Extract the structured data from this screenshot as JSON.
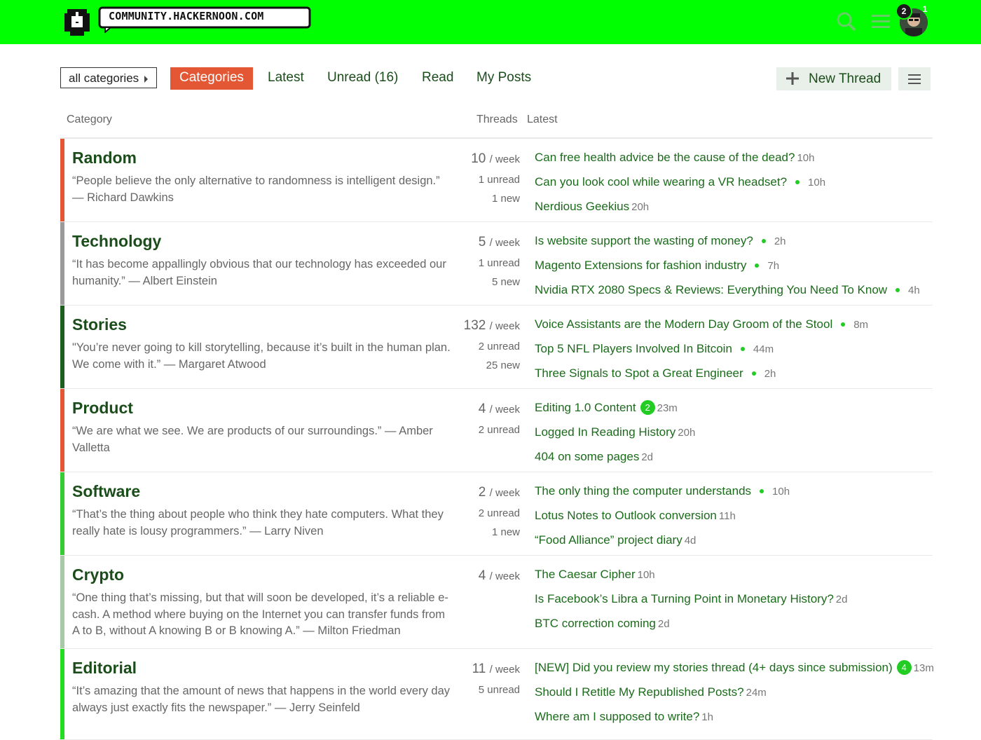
{
  "header": {
    "site_name": "COMMUNITY.HACKERNOON.COM",
    "pm_badge": "2",
    "notif_badge": "1",
    "accent": "#00ff00"
  },
  "nav": {
    "category_dropdown": "all categories",
    "tabs": [
      "Categories",
      "Latest",
      "Unread (16)",
      "Read",
      "My Posts"
    ],
    "new_thread": "New Thread"
  },
  "table": {
    "col_category": "Category",
    "col_threads": "Threads",
    "col_latest": "Latest"
  },
  "categories": [
    {
      "name": "Random",
      "color": "#e45735",
      "description": "“People believe the only alternative to randomness is intelligent design.” — Richard Dawkins",
      "per_week": "10",
      "week_label": "/ week",
      "unread": "1 unread",
      "new": "1 new",
      "topics": [
        {
          "title": "Can free health advice be the cause of the dead?",
          "dot": false,
          "age": "10h",
          "count": ""
        },
        {
          "title": "Can you look cool while wearing a VR headset?",
          "dot": true,
          "age": "10h",
          "count": ""
        },
        {
          "title": "Nerdious Geekius",
          "dot": false,
          "age": "20h",
          "count": ""
        }
      ]
    },
    {
      "name": "Technology",
      "color": "#9a9a9a",
      "description": "“It has become appallingly obvious that our technology has exceeded our humanity.” — Albert Einstein",
      "per_week": "5",
      "week_label": "/ week",
      "unread": "1 unread",
      "new": "5 new",
      "topics": [
        {
          "title": "Is website support the wasting of money?",
          "dot": true,
          "age": "2h",
          "count": ""
        },
        {
          "title": "Magento Extensions for fashion industry",
          "dot": true,
          "age": "7h",
          "count": ""
        },
        {
          "title": "Nvidia RTX 2080 Specs & Reviews: Everything You Need To Know",
          "dot": true,
          "age": "4h",
          "count": ""
        }
      ]
    },
    {
      "name": "Stories",
      "color": "#1b5e20",
      "description": "\"You’re never going to kill storytelling, because it’s built in the human plan. We come with it.” — Margaret Atwood",
      "per_week": "132",
      "week_label": "/ week",
      "unread": "2 unread",
      "new": "25 new",
      "topics": [
        {
          "title": "Voice Assistants are the Modern Day Groom of the Stool",
          "dot": true,
          "age": "8m",
          "count": ""
        },
        {
          "title": "Top 5 NFL Players Involved In Bitcoin",
          "dot": true,
          "age": "44m",
          "count": ""
        },
        {
          "title": "Three Signals to Spot a Great Engineer",
          "dot": true,
          "age": "2h",
          "count": ""
        }
      ]
    },
    {
      "name": "Product",
      "color": "#e45735",
      "description": "“We are what we see. We are products of our surroundings.” — Amber Valletta",
      "per_week": "4",
      "week_label": "/ week",
      "unread": "2 unread",
      "new": "",
      "topics": [
        {
          "title": "Editing 1.0 Content",
          "dot": false,
          "age": "23m",
          "count": "2"
        },
        {
          "title": "Logged In Reading History",
          "dot": false,
          "age": "20h",
          "count": ""
        },
        {
          "title": "404 on some pages",
          "dot": false,
          "age": "2d",
          "count": ""
        }
      ]
    },
    {
      "name": "Software",
      "color": "#33cc33",
      "description": "“That’s the thing about people who think they hate computers. What they really hate is lousy programmers.” — Larry Niven",
      "per_week": "2",
      "week_label": "/ week",
      "unread": "2 unread",
      "new": "1 new",
      "topics": [
        {
          "title": "The only thing the computer understands",
          "dot": true,
          "age": "10h",
          "count": ""
        },
        {
          "title": "Lotus Notes to Outlook conversion",
          "dot": false,
          "age": "11h",
          "count": ""
        },
        {
          "title": "“Food Alliance” project diary",
          "dot": false,
          "age": "4d",
          "count": ""
        }
      ]
    },
    {
      "name": "Crypto",
      "color": "#a8c8a8",
      "description": "“One thing that’s missing, but that will soon be developed, it’s a reliable e-cash. A method where buying on the Internet you can transfer funds from A to B, without A knowing B or B knowing A.” — Milton Friedman",
      "per_week": "4",
      "week_label": "/ week",
      "unread": "",
      "new": "",
      "topics": [
        {
          "title": "The Caesar Cipher",
          "dot": false,
          "age": "10h",
          "count": ""
        },
        {
          "title": "Is Facebook’s Libra a Turning Point in Monetary History?",
          "dot": false,
          "age": "2d",
          "count": ""
        },
        {
          "title": "BTC correction coming",
          "dot": false,
          "age": "2d",
          "count": ""
        }
      ]
    },
    {
      "name": "Editorial",
      "color": "#22dd22",
      "description": "“It’s amazing that the amount of news that happens in the world every day always just exactly fits the newspaper.” — Jerry Seinfeld",
      "per_week": "11",
      "week_label": "/ week",
      "unread": "5 unread",
      "new": "",
      "topics": [
        {
          "title": "[NEW] Did you review my stories thread (4+ days since submission)",
          "dot": false,
          "age": "13m",
          "count": "4"
        },
        {
          "title": "Should I Retitle My Republished Posts?",
          "dot": false,
          "age": "24m",
          "count": ""
        },
        {
          "title": "Where am I supposed to write?",
          "dot": false,
          "age": "1h",
          "count": ""
        }
      ]
    }
  ]
}
